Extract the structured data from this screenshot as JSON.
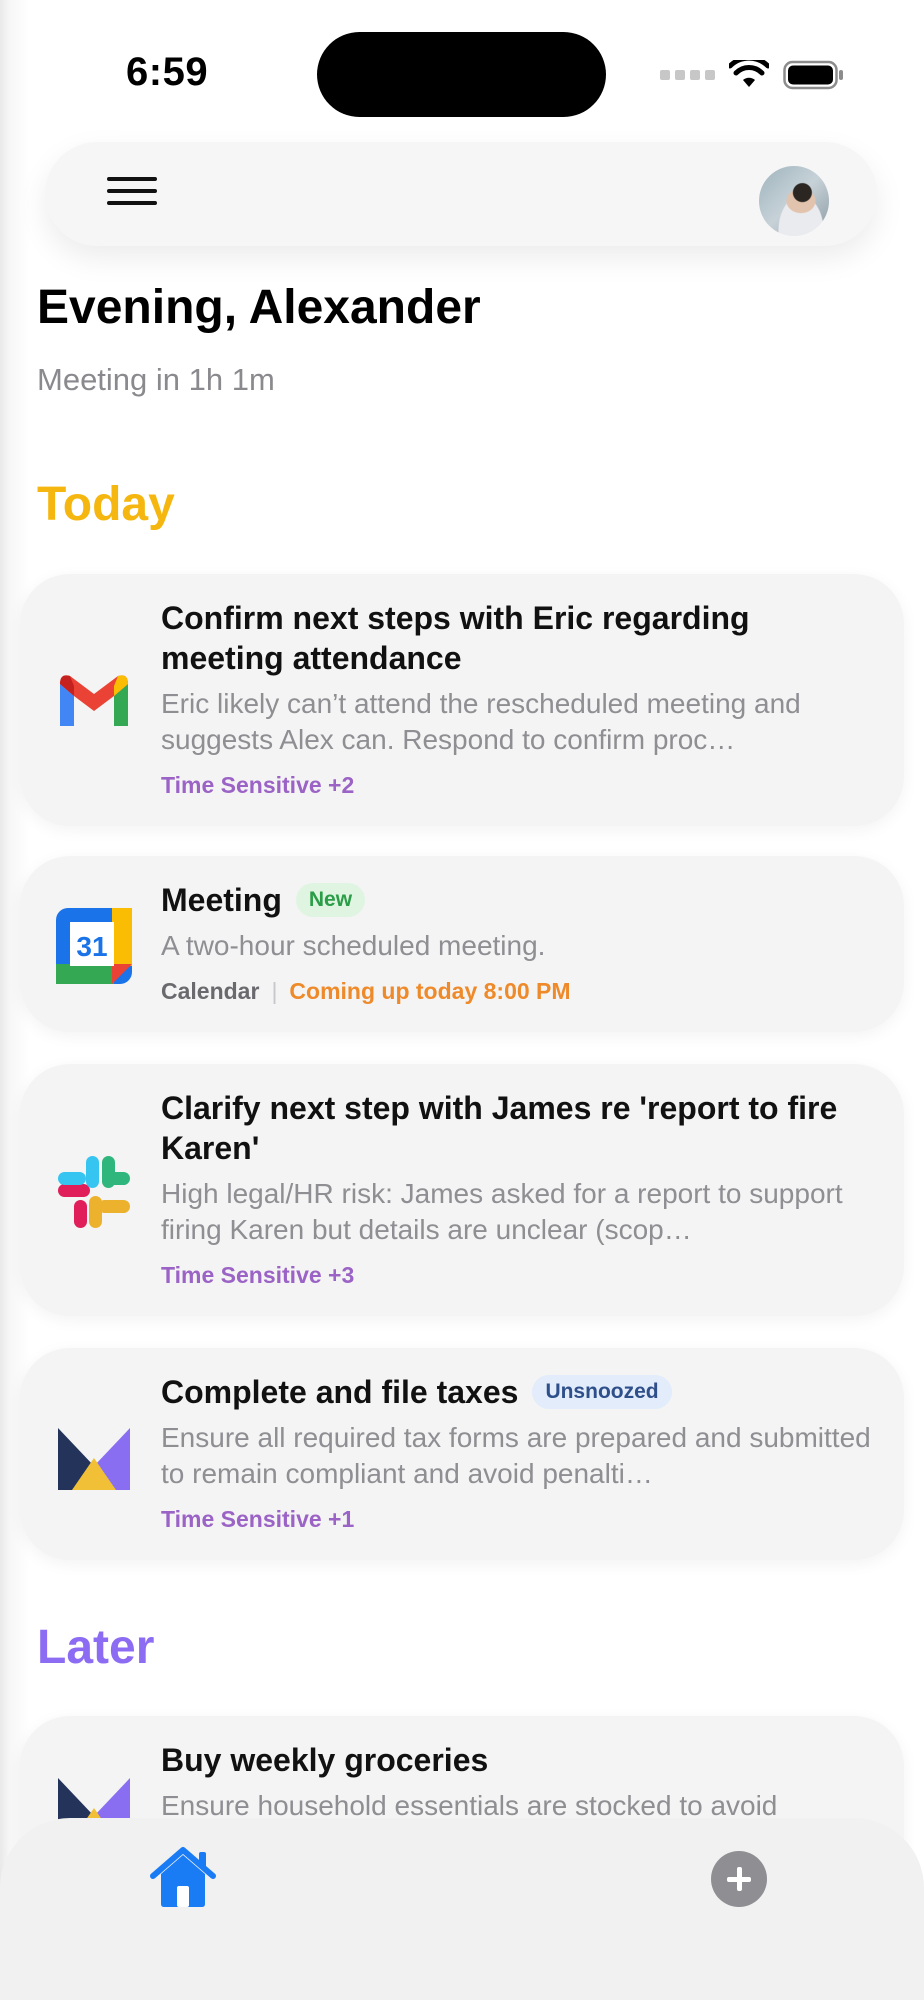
{
  "status_bar": {
    "time": "6:59"
  },
  "header": {
    "avatar_alt": "Alexander profile photo"
  },
  "greeting": {
    "title": "Evening, Alexander",
    "subtitle": "Meeting in 1h 1m"
  },
  "sections": {
    "today": "Today",
    "later": "Later"
  },
  "cards": [
    {
      "icon": "gmail-icon",
      "title": "Confirm next steps with Eric regarding meeting attendance",
      "description": "Eric likely can’t attend the rescheduled meeting and suggests Alex can. Respond to confirm proc…",
      "meta": "Time Sensitive +2"
    },
    {
      "icon": "google-calendar-icon",
      "title": "Meeting",
      "badge": "New",
      "description": "A two-hour scheduled meeting.",
      "source": "Calendar",
      "meta_divider": "|",
      "meta": "Coming up today 8:00 PM"
    },
    {
      "icon": "slack-icon",
      "title": "Clarify next step with James re 'report to fire Karen'",
      "description": "High legal/HR risk: James asked for a report to support firing Karen but details are unclear (scop…",
      "meta": "Time Sensitive +3"
    },
    {
      "icon": "app-logo-icon",
      "title": "Complete and file taxes",
      "badge": "Unsnoozed",
      "description": "Ensure all required tax forms are prepared and submitted to remain compliant and avoid penalti…",
      "meta": "Time Sensitive +1"
    },
    {
      "icon": "app-logo-icon",
      "title": "Buy weekly groceries",
      "description": "Ensure household essentials are stocked to avoid"
    }
  ],
  "colors": {
    "today": "#f5b70f",
    "later": "#8c6cf2",
    "time_sensitive": "#9a63c5",
    "coming_up": "#ee8a2a",
    "home_tab": "#1a7cf4"
  }
}
